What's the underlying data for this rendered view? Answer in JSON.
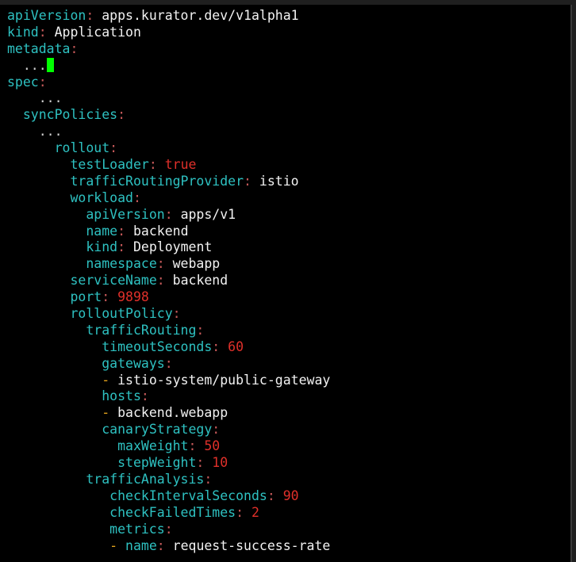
{
  "terminal": {
    "lines": [
      {
        "indent": 0,
        "key": "apiVersion",
        "value": "apps.kurator.dev/v1alpha1",
        "value_type": "text"
      },
      {
        "indent": 0,
        "key": "kind",
        "value": "Application",
        "value_type": "text"
      },
      {
        "indent": 0,
        "key": "metadata",
        "value": "",
        "value_type": "none"
      },
      {
        "indent": 2,
        "dots": "...",
        "cursor": true
      },
      {
        "indent": 0,
        "key": "spec",
        "value": "",
        "value_type": "none"
      },
      {
        "indent": 4,
        "dots": "..."
      },
      {
        "indent": 2,
        "key": "syncPolicies",
        "value": "",
        "value_type": "none"
      },
      {
        "indent": 4,
        "dots": "..."
      },
      {
        "indent": 6,
        "key": "rollout",
        "value": "",
        "value_type": "none"
      },
      {
        "indent": 8,
        "key": "testLoader",
        "value": "true",
        "value_type": "bool"
      },
      {
        "indent": 8,
        "key": "trafficRoutingProvider",
        "value": "istio",
        "value_type": "text"
      },
      {
        "indent": 8,
        "key": "workload",
        "value": "",
        "value_type": "none"
      },
      {
        "indent": 10,
        "key": "apiVersion",
        "value": "apps/v1",
        "value_type": "text"
      },
      {
        "indent": 10,
        "key": "name",
        "value": "backend",
        "value_type": "text"
      },
      {
        "indent": 10,
        "key": "kind",
        "value": "Deployment",
        "value_type": "text"
      },
      {
        "indent": 10,
        "key": "namespace",
        "value": "webapp",
        "value_type": "text"
      },
      {
        "indent": 8,
        "key": "serviceName",
        "value": "backend",
        "value_type": "text"
      },
      {
        "indent": 8,
        "key": "port",
        "value": "9898",
        "value_type": "number"
      },
      {
        "indent": 8,
        "key": "rolloutPolicy",
        "value": "",
        "value_type": "none"
      },
      {
        "indent": 10,
        "key": "trafficRouting",
        "value": "",
        "value_type": "none"
      },
      {
        "indent": 12,
        "key": "timeoutSeconds",
        "value": "60",
        "value_type": "number"
      },
      {
        "indent": 12,
        "key": "gateways",
        "value": "",
        "value_type": "none"
      },
      {
        "indent": 12,
        "list_item": "istio-system/public-gateway"
      },
      {
        "indent": 12,
        "key": "hosts",
        "value": "",
        "value_type": "none"
      },
      {
        "indent": 12,
        "list_item": "backend.webapp"
      },
      {
        "indent": 12,
        "key": "canaryStrategy",
        "value": "",
        "value_type": "none"
      },
      {
        "indent": 14,
        "key": "maxWeight",
        "value": "50",
        "value_type": "number"
      },
      {
        "indent": 14,
        "key": "stepWeight",
        "value": "10",
        "value_type": "number"
      },
      {
        "indent": 10,
        "key": "trafficAnalysis",
        "value": "",
        "value_type": "none"
      },
      {
        "indent": 13,
        "key": "checkIntervalSeconds",
        "value": "90",
        "value_type": "number"
      },
      {
        "indent": 13,
        "key": "checkFailedTimes",
        "value": "2",
        "value_type": "number"
      },
      {
        "indent": 13,
        "key": "metrics",
        "value": "",
        "value_type": "none"
      },
      {
        "indent": 13,
        "list_key": "name",
        "value": "request-success-rate",
        "value_type": "text"
      }
    ],
    "colors": {
      "background": "#000000",
      "key": "#2ec1c1",
      "colon": "#c85a5a",
      "value": "#f2f2f2",
      "number": "#e0302a",
      "dash": "#e5a31c",
      "cursor": "#00ff00"
    }
  }
}
